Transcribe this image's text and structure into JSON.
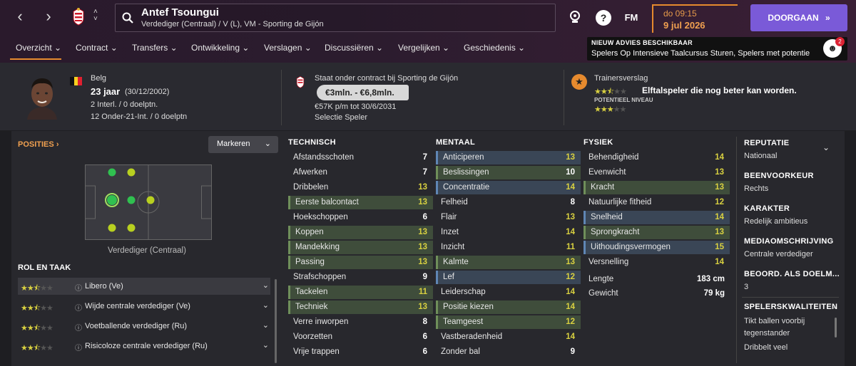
{
  "topbar": {
    "player_name": "Antef Tsoungui",
    "player_sub": "Verdediger (Centraal) / V (L), VM - Sporting de Gijón",
    "fm_label": "FM",
    "help_label": "?",
    "time": "do 09:15",
    "date": "9 jul 2026",
    "continue_label": "DOORGAAN",
    "advice_title": "NIEUW ADVIES BESCHIKBAAR",
    "advice_text": "Spelers Op Intensieve Taalcursus Sturen, Spelers met potentie",
    "advice_badge": "2"
  },
  "menu": [
    "Overzicht",
    "Contract",
    "Transfers",
    "Ontwikkeling",
    "Verslagen",
    "Discussiëren",
    "Vergelijken",
    "Geschiedenis"
  ],
  "header": {
    "nationality": "Belg",
    "age": "23 jaar",
    "dob": "(30/12/2002)",
    "intl": "2 Interl. / 0 doelptn.",
    "u21": "12 Onder-21-Int. / 0 doelptn",
    "contract_title": "Staat onder contract bij Sporting de Gijón",
    "value": "€3mln. - €6,8mln.",
    "wage": "€57K p/m tot 30/6/2031",
    "selection": "Selectie Speler",
    "report_title": "Trainersverslag",
    "report_text": "Elftalspeler die nog beter kan worden.",
    "potential_label": "POTENTIEEL NIVEAU",
    "current_stars": 2.5,
    "potential_stars": 3
  },
  "positions": {
    "title": "POSITIES",
    "mark_label": "Markeren",
    "position_name": "Verdediger (Centraal)"
  },
  "roles": {
    "title": "ROL EN TAAK",
    "items": [
      {
        "name": "Libero (Ve)",
        "stars": 2.5
      },
      {
        "name": "Wijde centrale verdediger (Ve)",
        "stars": 2.5
      },
      {
        "name": "Voetballende verdediger (Ru)",
        "stars": 2.5
      },
      {
        "name": "Risicoloze centrale verdediger (Ru)",
        "stars": 2.5
      }
    ]
  },
  "technisch": {
    "title": "TECHNISCH",
    "rows": [
      {
        "name": "Afstandsschoten",
        "value": "7",
        "hl": ""
      },
      {
        "name": "Afwerken",
        "value": "7",
        "hl": ""
      },
      {
        "name": "Dribbelen",
        "value": "13",
        "hl": ""
      },
      {
        "name": "Eerste balcontact",
        "value": "13",
        "hl": "green"
      },
      {
        "name": "Hoekschoppen",
        "value": "6",
        "hl": ""
      },
      {
        "name": "Koppen",
        "value": "13",
        "hl": "green"
      },
      {
        "name": "Mandekking",
        "value": "13",
        "hl": "green"
      },
      {
        "name": "Passing",
        "value": "13",
        "hl": "green"
      },
      {
        "name": "Strafschoppen",
        "value": "9",
        "hl": ""
      },
      {
        "name": "Tackelen",
        "value": "11",
        "hl": "green"
      },
      {
        "name": "Techniek",
        "value": "13",
        "hl": "green"
      },
      {
        "name": "Verre inworpen",
        "value": "8",
        "hl": ""
      },
      {
        "name": "Voorzetten",
        "value": "6",
        "hl": ""
      },
      {
        "name": "Vrije trappen",
        "value": "6",
        "hl": ""
      }
    ]
  },
  "mentaal": {
    "title": "MENTAAL",
    "rows": [
      {
        "name": "Anticiperen",
        "value": "13",
        "hl": "blue"
      },
      {
        "name": "Beslissingen",
        "value": "10",
        "hl": "green"
      },
      {
        "name": "Concentratie",
        "value": "14",
        "hl": "blue"
      },
      {
        "name": "Felheid",
        "value": "8",
        "hl": ""
      },
      {
        "name": "Flair",
        "value": "13",
        "hl": ""
      },
      {
        "name": "Inzet",
        "value": "14",
        "hl": ""
      },
      {
        "name": "Inzicht",
        "value": "11",
        "hl": ""
      },
      {
        "name": "Kalmte",
        "value": "13",
        "hl": "green"
      },
      {
        "name": "Lef",
        "value": "12",
        "hl": "blue"
      },
      {
        "name": "Leiderschap",
        "value": "14",
        "hl": ""
      },
      {
        "name": "Positie kiezen",
        "value": "14",
        "hl": "green"
      },
      {
        "name": "Teamgeest",
        "value": "12",
        "hl": "green"
      },
      {
        "name": "Vastberadenheid",
        "value": "14",
        "hl": ""
      },
      {
        "name": "Zonder bal",
        "value": "9",
        "hl": ""
      }
    ]
  },
  "fysiek": {
    "title": "FYSIEK",
    "rows": [
      {
        "name": "Behendigheid",
        "value": "14",
        "hl": ""
      },
      {
        "name": "Evenwicht",
        "value": "13",
        "hl": ""
      },
      {
        "name": "Kracht",
        "value": "13",
        "hl": "green"
      },
      {
        "name": "Natuurlijke fitheid",
        "value": "12",
        "hl": ""
      },
      {
        "name": "Snelheid",
        "value": "14",
        "hl": "blue"
      },
      {
        "name": "Sprongkracht",
        "value": "13",
        "hl": "green"
      },
      {
        "name": "Uithoudingsvermogen",
        "value": "15",
        "hl": "blue"
      },
      {
        "name": "Versnelling",
        "value": "14",
        "hl": ""
      }
    ],
    "length_label": "Lengte",
    "length": "183 cm",
    "weight_label": "Gewicht",
    "weight": "79 kg"
  },
  "right": {
    "reputation_label": "REPUTATIE",
    "reputation": "Nationaal",
    "foot_label": "BEENVOORKEUR",
    "foot": "Rechts",
    "character_label": "KARAKTER",
    "character": "Redelijk ambitieus",
    "media_label": "MEDIAOMSCHRIJVING",
    "media": "Centrale verdediger",
    "gk_label": "BEOORD. ALS DOELM...",
    "gk": "3",
    "qual_label": "SPELERSKWALITEITEN",
    "qual1": "Tikt ballen voorbij",
    "qual2": "tegenstander",
    "qual3": "Dribbelt veel"
  },
  "colors": {
    "accent": "#e68a2e",
    "button": "#7a5ad8",
    "yellow_value": "#d8d040",
    "green_hl": "#3f4d3b",
    "blue_hl": "#3a4656"
  }
}
